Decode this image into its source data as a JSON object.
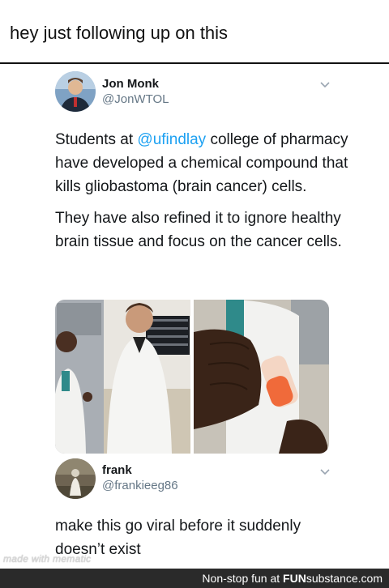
{
  "caption": "hey just following up on this",
  "tweet1": {
    "name": "Jon Monk",
    "handle": "@JonWTOL",
    "text_pre": "Students at ",
    "mention": "@ufindlay",
    "text_post": " college of pharmacy have developed a chemical compound that kills gliobastoma (brain cancer) cells.",
    "text2": "They have also refined it to ignore healthy brain tissue and focus on the cancer cells."
  },
  "tweet2": {
    "name": "frank",
    "handle": "@frankieeg86",
    "text": "make this go viral before it suddenly doesn’t exist"
  },
  "watermark": "made with mematic",
  "footer": {
    "prefix": "Non-stop fun at ",
    "brand_bold": "FUN",
    "brand_rest": "substance.com"
  },
  "colors": {
    "link": "#1da1f2",
    "muted": "#657786",
    "footer_bg": "#2a2a2a"
  },
  "icons": {
    "chevron": "chevron-down-icon"
  }
}
